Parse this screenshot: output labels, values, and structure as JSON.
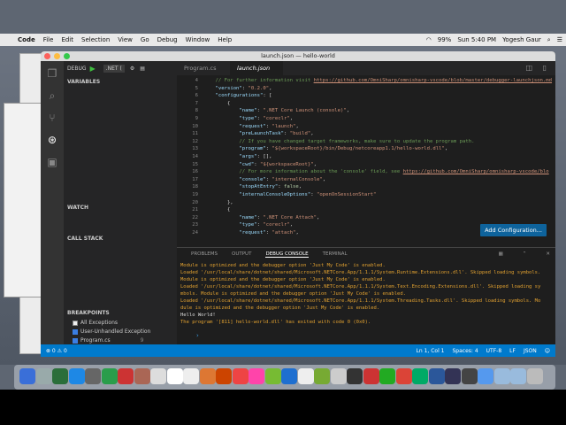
{
  "menubar": {
    "app": "Code",
    "items": [
      "File",
      "Edit",
      "Selection",
      "View",
      "Go",
      "Debug",
      "Window",
      "Help"
    ],
    "battery": "99%",
    "clock": "Sun 5:40 PM",
    "user": "Yogesh Gaur"
  },
  "window": {
    "title": "launch.json — hello-world"
  },
  "debug": {
    "label": "DEBUG",
    ".config": ".NET(",
    "config": ".NET ("
  },
  "sidebar": {
    "variables": "VARIABLES",
    "watch": "WATCH",
    "callstack": "CALL STACK",
    "breakpoints": "BREAKPOINTS",
    "bps": [
      {
        "label": "All Exceptions",
        "checked": false
      },
      {
        "label": "User-Unhandled Exception",
        "checked": true
      },
      {
        "label": "Program.cs",
        "checked": true,
        "count": "9"
      }
    ]
  },
  "tabs": [
    {
      "label": "Program.cs"
    },
    {
      "label": "launch.json"
    }
  ],
  "editor": {
    "lines": [
      {
        "n": "4",
        "parts": [
          {
            "t": "    // For further information visit ",
            "c": "c"
          },
          {
            "t": "https://github.com/OmniSharp/omnisharp-vscode/blob/master/debugger-launchjson.md",
            "c": "u"
          }
        ]
      },
      {
        "n": "5",
        "parts": [
          {
            "t": "    ",
            "c": ""
          },
          {
            "t": "\"version\"",
            "c": "k"
          },
          {
            "t": ": ",
            "c": ""
          },
          {
            "t": "\"0.2.0\"",
            "c": "s"
          },
          {
            "t": ",",
            "c": ""
          }
        ]
      },
      {
        "n": "6",
        "parts": [
          {
            "t": "    ",
            "c": ""
          },
          {
            "t": "\"configurations\"",
            "c": "k"
          },
          {
            "t": ": [",
            "c": ""
          }
        ]
      },
      {
        "n": "7",
        "parts": [
          {
            "t": "        {",
            "c": ""
          }
        ]
      },
      {
        "n": "8",
        "parts": [
          {
            "t": "            ",
            "c": ""
          },
          {
            "t": "\"name\"",
            "c": "k"
          },
          {
            "t": ": ",
            "c": ""
          },
          {
            "t": "\".NET Core Launch (console)\"",
            "c": "s"
          },
          {
            "t": ",",
            "c": ""
          }
        ]
      },
      {
        "n": "9",
        "parts": [
          {
            "t": "            ",
            "c": ""
          },
          {
            "t": "\"type\"",
            "c": "k"
          },
          {
            "t": ": ",
            "c": ""
          },
          {
            "t": "\"coreclr\"",
            "c": "s"
          },
          {
            "t": ",",
            "c": ""
          }
        ]
      },
      {
        "n": "10",
        "parts": [
          {
            "t": "            ",
            "c": ""
          },
          {
            "t": "\"request\"",
            "c": "k"
          },
          {
            "t": ": ",
            "c": ""
          },
          {
            "t": "\"launch\"",
            "c": "s"
          },
          {
            "t": ",",
            "c": ""
          }
        ]
      },
      {
        "n": "11",
        "parts": [
          {
            "t": "            ",
            "c": ""
          },
          {
            "t": "\"preLaunchTask\"",
            "c": "k"
          },
          {
            "t": ": ",
            "c": ""
          },
          {
            "t": "\"build\"",
            "c": "s"
          },
          {
            "t": ",",
            "c": ""
          }
        ]
      },
      {
        "n": "12",
        "parts": [
          {
            "t": "            // If you have changed target frameworks, make sure to update the program path.",
            "c": "c"
          }
        ]
      },
      {
        "n": "13",
        "parts": [
          {
            "t": "            ",
            "c": ""
          },
          {
            "t": "\"program\"",
            "c": "k"
          },
          {
            "t": ": ",
            "c": ""
          },
          {
            "t": "\"${workspaceRoot}/bin/Debug/netcoreapp1.1/hello-world.dll\"",
            "c": "s"
          },
          {
            "t": ",",
            "c": ""
          }
        ]
      },
      {
        "n": "14",
        "parts": [
          {
            "t": "            ",
            "c": ""
          },
          {
            "t": "\"args\"",
            "c": "k"
          },
          {
            "t": ": [],",
            "c": ""
          }
        ]
      },
      {
        "n": "15",
        "parts": [
          {
            "t": "            ",
            "c": ""
          },
          {
            "t": "\"cwd\"",
            "c": "k"
          },
          {
            "t": ": ",
            "c": ""
          },
          {
            "t": "\"${workspaceRoot}\"",
            "c": "s"
          },
          {
            "t": ",",
            "c": ""
          }
        ]
      },
      {
        "n": "16",
        "parts": [
          {
            "t": "            // For more information about the 'console' field, see ",
            "c": "c"
          },
          {
            "t": "https://github.com/OmniSharp/omnisharp-vscode/blo",
            "c": "u"
          }
        ]
      },
      {
        "n": "17",
        "parts": [
          {
            "t": "            ",
            "c": ""
          },
          {
            "t": "\"console\"",
            "c": "k"
          },
          {
            "t": ": ",
            "c": ""
          },
          {
            "t": "\"internalConsole\"",
            "c": "s"
          },
          {
            "t": ",",
            "c": ""
          }
        ]
      },
      {
        "n": "18",
        "parts": [
          {
            "t": "            ",
            "c": ""
          },
          {
            "t": "\"stopAtEntry\"",
            "c": "k"
          },
          {
            "t": ": ",
            "c": ""
          },
          {
            "t": "false",
            "c": "n"
          },
          {
            "t": ",",
            "c": ""
          }
        ]
      },
      {
        "n": "19",
        "parts": [
          {
            "t": "            ",
            "c": ""
          },
          {
            "t": "\"internalConsoleOptions\"",
            "c": "k"
          },
          {
            "t": ": ",
            "c": ""
          },
          {
            "t": "\"openOnSessionStart\"",
            "c": "s"
          }
        ]
      },
      {
        "n": "20",
        "parts": [
          {
            "t": "        },",
            "c": ""
          }
        ]
      },
      {
        "n": "21",
        "parts": [
          {
            "t": "        {",
            "c": ""
          }
        ]
      },
      {
        "n": "22",
        "parts": [
          {
            "t": "            ",
            "c": ""
          },
          {
            "t": "\"name\"",
            "c": "k"
          },
          {
            "t": ": ",
            "c": ""
          },
          {
            "t": "\".NET Core Attach\"",
            "c": "s"
          },
          {
            "t": ",",
            "c": ""
          }
        ]
      },
      {
        "n": "23",
        "parts": [
          {
            "t": "            ",
            "c": ""
          },
          {
            "t": "\"type\"",
            "c": "k"
          },
          {
            "t": ": ",
            "c": ""
          },
          {
            "t": "\"coreclr\"",
            "c": "s"
          },
          {
            "t": ",",
            "c": ""
          }
        ]
      },
      {
        "n": "24",
        "parts": [
          {
            "t": "            ",
            "c": ""
          },
          {
            "t": "\"request\"",
            "c": "k"
          },
          {
            "t": ": ",
            "c": ""
          },
          {
            "t": "\"attach\"",
            "c": "s"
          },
          {
            "t": ",",
            "c": ""
          }
        ]
      }
    ],
    "add_config": "Add Configuration..."
  },
  "panel": {
    "tabs": [
      "PROBLEMS",
      "OUTPUT",
      "DEBUG CONSOLE",
      "TERMINAL"
    ],
    "console": [
      {
        "t": " Module is optimized and the debugger option 'Just My Code' is enabled.",
        "c": ""
      },
      {
        "t": "Loaded '/usr/local/share/dotnet/shared/Microsoft.NETCore.App/1.1.1/System.Runtime.Extensions.dll'. Skipped loading symbols.",
        "c": ""
      },
      {
        "t": " Module is optimized and the debugger option 'Just My Code' is enabled.",
        "c": ""
      },
      {
        "t": "Loaded '/usr/local/share/dotnet/shared/Microsoft.NETCore.App/1.1.1/System.Text.Encoding.Extensions.dll'. Skipped loading sy",
        "c": ""
      },
      {
        "t": "mbols. Module is optimized and the debugger option 'Just My Code' is enabled.",
        "c": ""
      },
      {
        "t": "Loaded '/usr/local/share/dotnet/shared/Microsoft.NETCore.App/1.1.1/System.Threading.Tasks.dll'. Skipped loading symbols. Mo",
        "c": ""
      },
      {
        "t": "dule is optimized and the debugger option 'Just My Code' is enabled.",
        "c": ""
      },
      {
        "t": "Hello World!",
        "c": "w"
      },
      {
        "t": "The program '[811] hello-world.dll' has exited with code 0 (0x0).",
        "c": ""
      }
    ]
  },
  "status": {
    "left": "⊗ 0 ⚠ 0",
    "position": "Ln 1, Col 1",
    "spaces": "Spaces: 4",
    "encoding": "UTF-8",
    "eol": "LF",
    "lang": "JSON"
  },
  "colors": {
    "statusbar": "#007acc",
    "accent": "#0e639c",
    "activity": "#333333",
    "sidebar": "#252526",
    "editor": "#1e1e1e"
  }
}
